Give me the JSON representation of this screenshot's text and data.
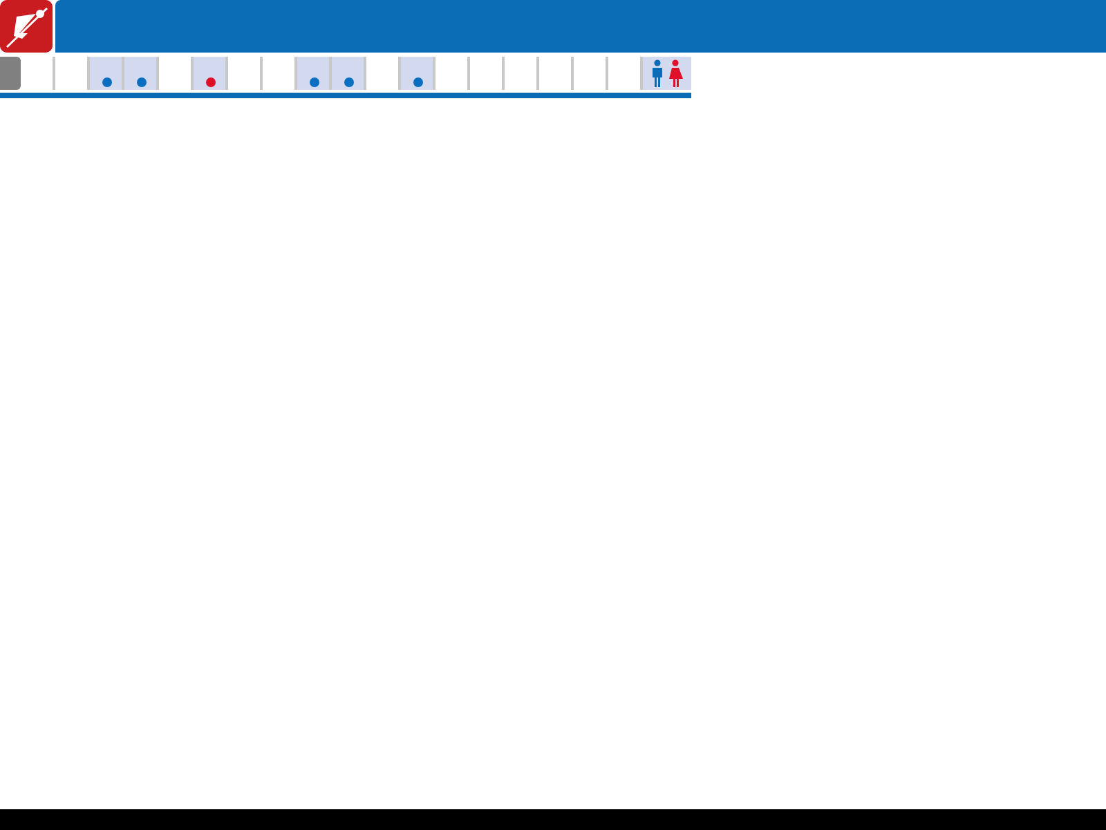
{
  "days": [
    {
      "has_event": false
    },
    {
      "has_event": false
    },
    {
      "has_event": true,
      "color": "#0a6fc0"
    },
    {
      "has_event": true,
      "color": "#0a6fc0"
    },
    {
      "has_event": false
    },
    {
      "has_event": true,
      "color": "#e0102a"
    },
    {
      "has_event": false
    },
    {
      "has_event": false
    },
    {
      "has_event": true,
      "color": "#0a6fc0"
    },
    {
      "has_event": true,
      "color": "#0a6fc0"
    },
    {
      "has_event": false
    },
    {
      "has_event": true,
      "color": "#0a6fc0"
    },
    {
      "has_event": false
    },
    {
      "has_event": false
    },
    {
      "has_event": false
    },
    {
      "has_event": false
    },
    {
      "has_event": false
    },
    {
      "has_event": false
    }
  ]
}
